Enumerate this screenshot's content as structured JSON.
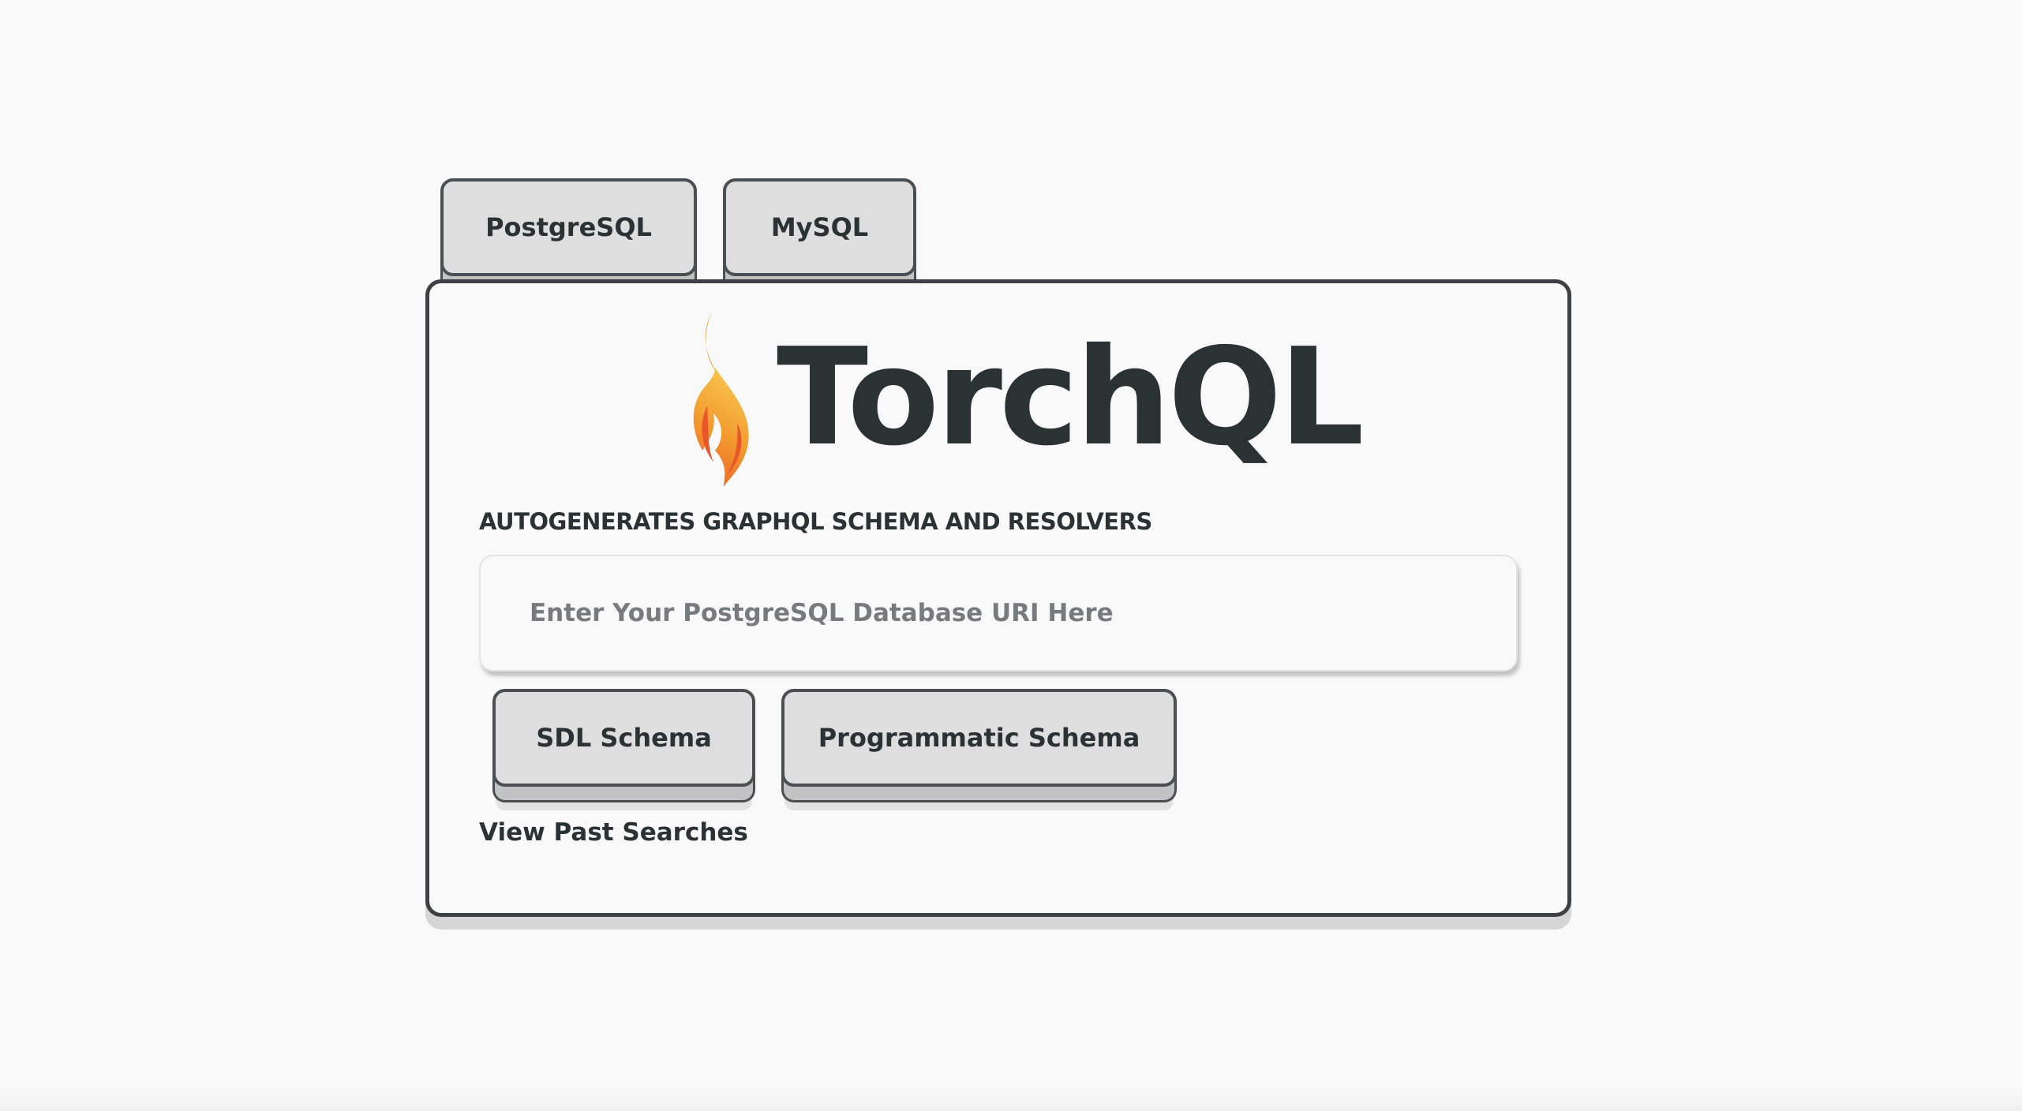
{
  "db_tabs": [
    {
      "label": "PostgreSQL"
    },
    {
      "label": "MySQL"
    }
  ],
  "brand": {
    "name": "TorchQL",
    "tagline": "AUTOGENERATES GRAPHQL SCHEMA AND RESOLVERS",
    "logo_icon": "flame-icon",
    "logo_colors": [
      "#e8572a",
      "#f39a2e",
      "#f7c04a"
    ]
  },
  "uri_input": {
    "value": "",
    "placeholder": "Enter Your PostgreSQL Database URI Here"
  },
  "actions": {
    "sdl_label": "SDL Schema",
    "programmatic_label": "Programmatic Schema"
  },
  "history": {
    "link_label": "View Past Searches"
  },
  "colors": {
    "background": "#f9f9f9",
    "text": "#2b3234",
    "border": "#3c4244",
    "button_face": "#dedede"
  }
}
